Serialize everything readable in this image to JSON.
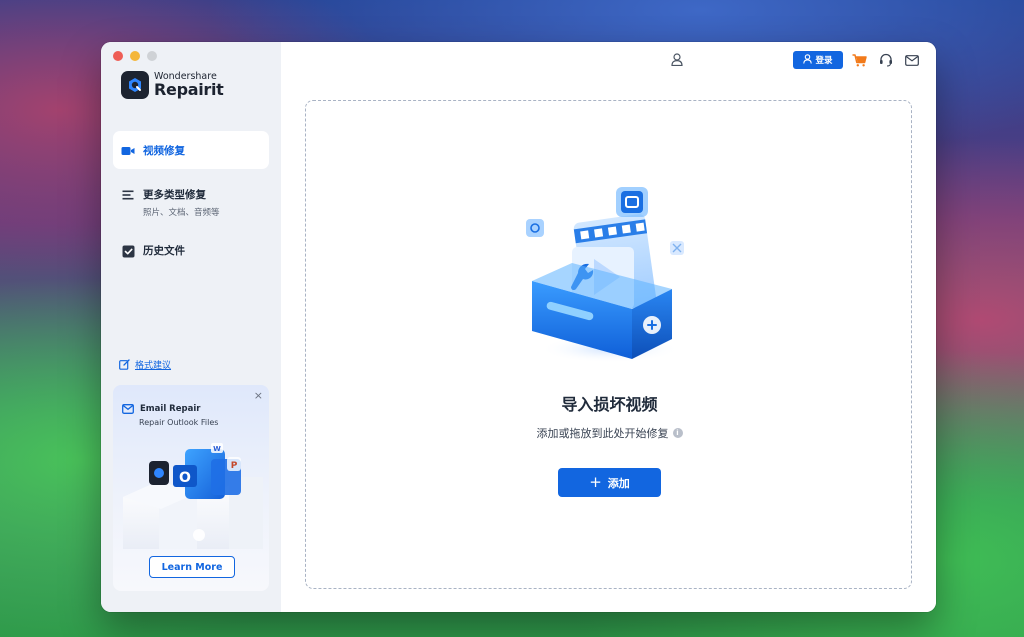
{
  "app": {
    "brand": "Wondershare",
    "product": "Repairit"
  },
  "sidebar": {
    "items": [
      {
        "label": "视频修复",
        "sub": "",
        "icon": "video-camera-icon",
        "active": true
      },
      {
        "label": "更多类型修复",
        "sub": "照片、文档、音频等",
        "icon": "list-icon",
        "active": false
      },
      {
        "label": "历史文件",
        "sub": "",
        "icon": "history-check-icon",
        "active": false
      }
    ],
    "feedback_label": "格式建议"
  },
  "promo": {
    "title": "Email Repair",
    "subtitle": "Repair Outlook Files",
    "button_label": "Learn More",
    "close_glyph": "×"
  },
  "header": {
    "login_label": "登录"
  },
  "dropzone": {
    "title": "导入损坏视频",
    "subtitle": "添加或拖放到此处开始修复",
    "add_label": "添加",
    "add_glyph": "+",
    "info_glyph": "i"
  },
  "colors": {
    "accent": "#1266e0",
    "cart": "#f27a1a",
    "sidebar_bg": "#eef1f6"
  }
}
